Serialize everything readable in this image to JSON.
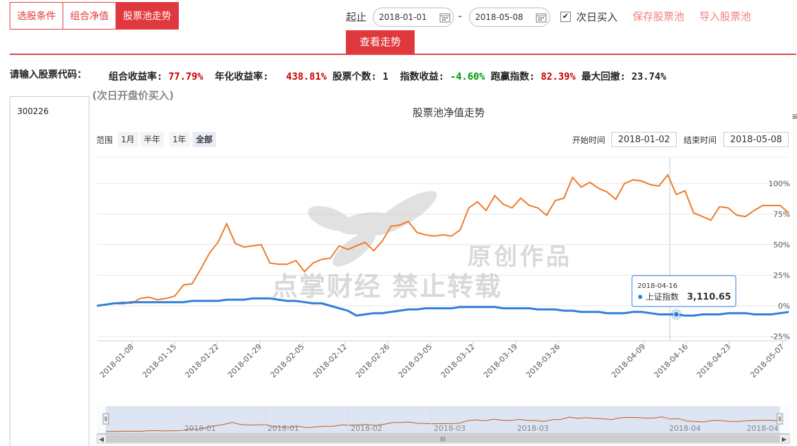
{
  "tabs": [
    {
      "label": "选股条件"
    },
    {
      "label": "组合净值"
    },
    {
      "label": "股票池走势"
    }
  ],
  "controls": {
    "start_label": "起止",
    "start_date": "2018-01-01",
    "dash": "-",
    "end_date": "2018-05-08",
    "next_day_label": "次日买入",
    "next_day_checked": true,
    "save_label": "保存股票池",
    "import_label": "导入股票池",
    "view_label": "查看走势"
  },
  "sidebar": {
    "prompt": "请输入股票代码：",
    "codes": "300226"
  },
  "stats": {
    "portfolio_return_label": "组合收益率:",
    "portfolio_return": "77.79%",
    "annual_return_label": "年化收益率:",
    "annual_return": "438.81%",
    "stock_count_label": "股票个数:",
    "stock_count": "1",
    "index_return_label": "指数收益:",
    "index_return": "-4.60%",
    "beat_index_label": "跑赢指数:",
    "beat_index": "82.39%",
    "max_drawdown_label": "最大回撤:",
    "max_drawdown": "23.74%",
    "note": "(次日开盘价买入)"
  },
  "chart_header": {
    "title": "股票池净值走势",
    "range_label": "范围",
    "range_buttons": [
      "1月",
      "半年",
      "1年",
      "全部"
    ],
    "range_selected": "全部",
    "start_time_label": "开始时间",
    "start_time": "2018-01-02",
    "end_time_label": "结束时间",
    "end_time": "2018-05-08",
    "menu_icon": "hamburger-icon"
  },
  "watermark": {
    "line1": "原创作品",
    "line2": "点掌财经 禁止转载"
  },
  "tooltip": {
    "date": "2018-04-16",
    "series": "上证指数",
    "value": "3,110.65"
  },
  "navigator": {
    "labels": [
      "2018-01",
      "2018-01",
      "2018-02",
      "2018-03",
      "2018-03",
      "2018-04",
      "2018-04"
    ]
  },
  "colors": {
    "accent": "#e0393d",
    "portfolio": "#f07a28",
    "index": "#2f7ed8"
  },
  "chart_data": {
    "type": "line",
    "x_ticks": [
      "2018-01-08",
      "2018-01-15",
      "2018-01-22",
      "2018-01-29",
      "2018-02-05",
      "2018-02-12",
      "2018-02-26",
      "2018-03-05",
      "2018-03-12",
      "2018-03-19",
      "2018-03-26",
      "2018-04-09",
      "2018-04-16",
      "2018-04-23",
      "2018-05-07"
    ],
    "y_ticks": [
      "-25%",
      "0%",
      "25%",
      "50%",
      "75%",
      "100%"
    ],
    "ylim": [
      -25,
      100
    ],
    "series": [
      {
        "name": "组合净值",
        "values": [
          0,
          1,
          2,
          3,
          2,
          6,
          7,
          5,
          6,
          8,
          17,
          18,
          30,
          43,
          52,
          67,
          51,
          48,
          49,
          50,
          35,
          34,
          34,
          37,
          28,
          35,
          38,
          39,
          49,
          46,
          49,
          52,
          45,
          53,
          65,
          66,
          69,
          60,
          58,
          57,
          58,
          57,
          62,
          80,
          85,
          78,
          90,
          83,
          80,
          88,
          82,
          80,
          74,
          86,
          88,
          105,
          97,
          101,
          96,
          93,
          87,
          100,
          103,
          102,
          99,
          98,
          107,
          91,
          94,
          76,
          73,
          70,
          81,
          80,
          74,
          73,
          78,
          82,
          82,
          82,
          76
        ]
      },
      {
        "name": "上证指数",
        "values": [
          0,
          1,
          2,
          2,
          3,
          3,
          3,
          3,
          3,
          3,
          3,
          4,
          4,
          4,
          4,
          5,
          5,
          5,
          6,
          6,
          6,
          5,
          4,
          4,
          3,
          2,
          2,
          0,
          -2,
          -4,
          -8,
          -7,
          -6,
          -6,
          -5,
          -4,
          -3,
          -3,
          -2,
          -2,
          -2,
          -2,
          -1,
          -1,
          -1,
          -1,
          -1,
          -2,
          -2,
          -2,
          -2,
          -3,
          -3,
          -3,
          -4,
          -4,
          -5,
          -5,
          -5,
          -6,
          -6,
          -6,
          -5,
          -5,
          -6,
          -7,
          -7,
          -7,
          -8,
          -8,
          -7,
          -7,
          -7,
          -6,
          -6,
          -6,
          -7,
          -7,
          -7,
          -6,
          -5
        ]
      }
    ]
  }
}
